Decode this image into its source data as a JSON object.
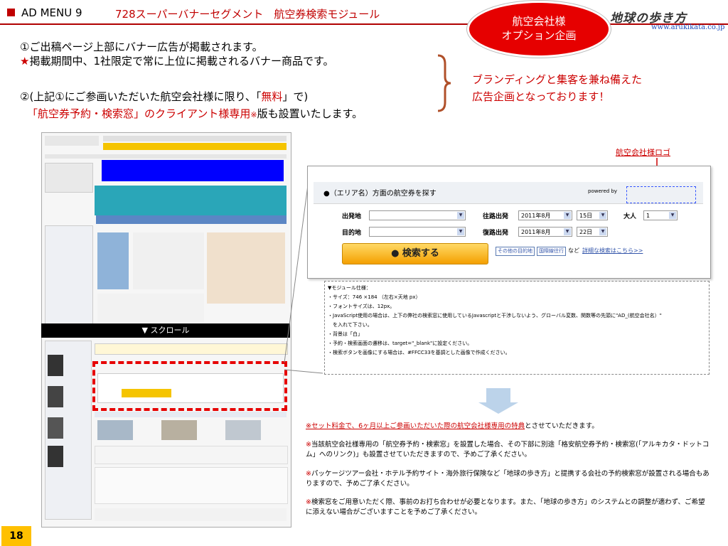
{
  "header": {
    "menu": "AD MENU 9",
    "title": "728スーパーバナーセグメント　航空券検索モジュール",
    "oval": [
      "航空会社様",
      "オプション企画"
    ],
    "logo": "地球の歩き方",
    "logo_url": "www.arukikata.co.jp"
  },
  "intro": {
    "line1": "①ご出稿ページ上部にバナー広告が掲載されます。",
    "line2_star": "★",
    "line2": "掲載期間中、1社限定で常に上位に掲載されるバナー商品です。",
    "line3_a": "②(上記①にご参画いただいた航空会社様に限り、「",
    "line3_free": "無料",
    "line3_b": "」で)",
    "line4_red": "「航空券予約・検索窓」のクライアント様専用",
    "line4_mark": "※",
    "line4_b": "版も設置いたします。"
  },
  "brand": [
    "ブランディングと集客を兼ね備えた",
    "広告企画となっております！"
  ],
  "screenshot": {
    "scroll_label": "▼ スクロール"
  },
  "module": {
    "logo_label": "航空会社様ロゴ",
    "title": "●（エリア名）方面の航空券を探す",
    "powered_by": "powered by",
    "from_label": "出発地",
    "to_label": "目的地",
    "out_label": "往路出発",
    "ret_label": "復路出発",
    "adult_label": "大人",
    "out_month": "2011年8月",
    "out_day": "15日",
    "ret_month": "2011年8月",
    "ret_day": "22日",
    "adult_count": "1",
    "search_button": "● 検索する",
    "link1": "その他の目的地",
    "link2": "国際線往行",
    "link_mid": "など",
    "link3": "詳細な検索はこちら>>"
  },
  "spec": [
    "▼モジュール仕様：",
    "・サイズ：746 ×184 （左右×天地 px）",
    "・フォントサイズは、12px。",
    "・JavaScript使用の場合は、上下の弊社の検索窓に使用しているJavascriptと干渉しないよう、グローバル変数、関数等の先頭に\"AD_(航空会社名）\"",
    "　を入れて下さい。",
    "・背景は「白」",
    "・予約・検索画面の遷移は、target=\"_blank\"に設定ください。",
    "・検索ボタンを画像にする場合は、#FFCC33を基調とした画像で作成ください。"
  ],
  "notes": {
    "n1_red": "※セット料金で、6ヶ月以上ご参画いただいた際の航空会社様専用の特典",
    "n1_b": "とさせていただきます。",
    "n2_mark": "※",
    "n2": "当該航空会社様専用の「航空券予約・検索窓」を設置した場合、その下部に別途「格安航空券予約・検索窓(「アルキカタ・ドットコム」へのリンク)」も設置させていただきますので、予めご了承ください。",
    "n3_mark": "※",
    "n3": "パッケージツアー会社・ホテル予約サイト・海外旅行保険など「地球の歩き方」と提携する会社の予約検索窓が設置される場合もありますので、予めご了承ください。",
    "n4_mark": "※",
    "n4": "検索窓をご用意いただく際、事前のお打ち合わせが必要となります。また、「地球の歩き方」のシステムとの調整が適わず、ご希望に添えない場合がございますことを予めご了承ください。"
  },
  "page_number": "18",
  "colors": {
    "accent_red": "#cc0000",
    "oval": "#e60000",
    "page_badge": "#ffc000",
    "search_button": "#FFCC33"
  }
}
